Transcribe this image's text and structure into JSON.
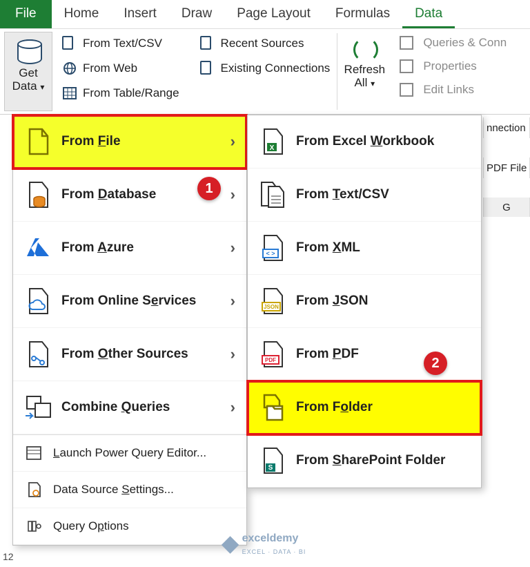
{
  "tabs": {
    "file": "File",
    "home": "Home",
    "insert": "Insert",
    "draw": "Draw",
    "page_layout": "Page Layout",
    "formulas": "Formulas",
    "data": "Data"
  },
  "ribbon": {
    "get_data": "Get Data",
    "from_text_csv": "From Text/CSV",
    "from_web": "From Web",
    "from_table_range": "From Table/Range",
    "recent_sources": "Recent Sources",
    "existing_connections": "Existing Connections",
    "refresh_all": "Refresh All",
    "queries_conn": "Queries & Conn",
    "properties": "Properties",
    "edit_links": "Edit Links"
  },
  "menu": {
    "from_file": "From File",
    "from_database": "From Database",
    "from_azure": "From Azure",
    "from_online_services": "From Online Services",
    "from_other_sources": "From Other Sources",
    "combine_queries": "Combine Queries",
    "launch_pqe": "Launch Power Query Editor...",
    "data_source_settings": "Data Source Settings...",
    "query_options": "Query Options"
  },
  "submenu": {
    "from_excel_workbook": "From Excel Workbook",
    "from_text_csv": "From Text/CSV",
    "from_xml": "From XML",
    "from_json": "From JSON",
    "from_pdf": "From PDF",
    "from_folder": "From Folder",
    "from_sharepoint_folder": "From SharePoint Folder"
  },
  "badges": {
    "b1": "1",
    "b2": "2"
  },
  "bg": {
    "connection_group": "nnection",
    "col_label": "PDF File",
    "col_g": "G",
    "rownum": "12"
  },
  "watermark": {
    "brand": "exceldemy",
    "tag": "EXCEL · DATA · BI"
  }
}
